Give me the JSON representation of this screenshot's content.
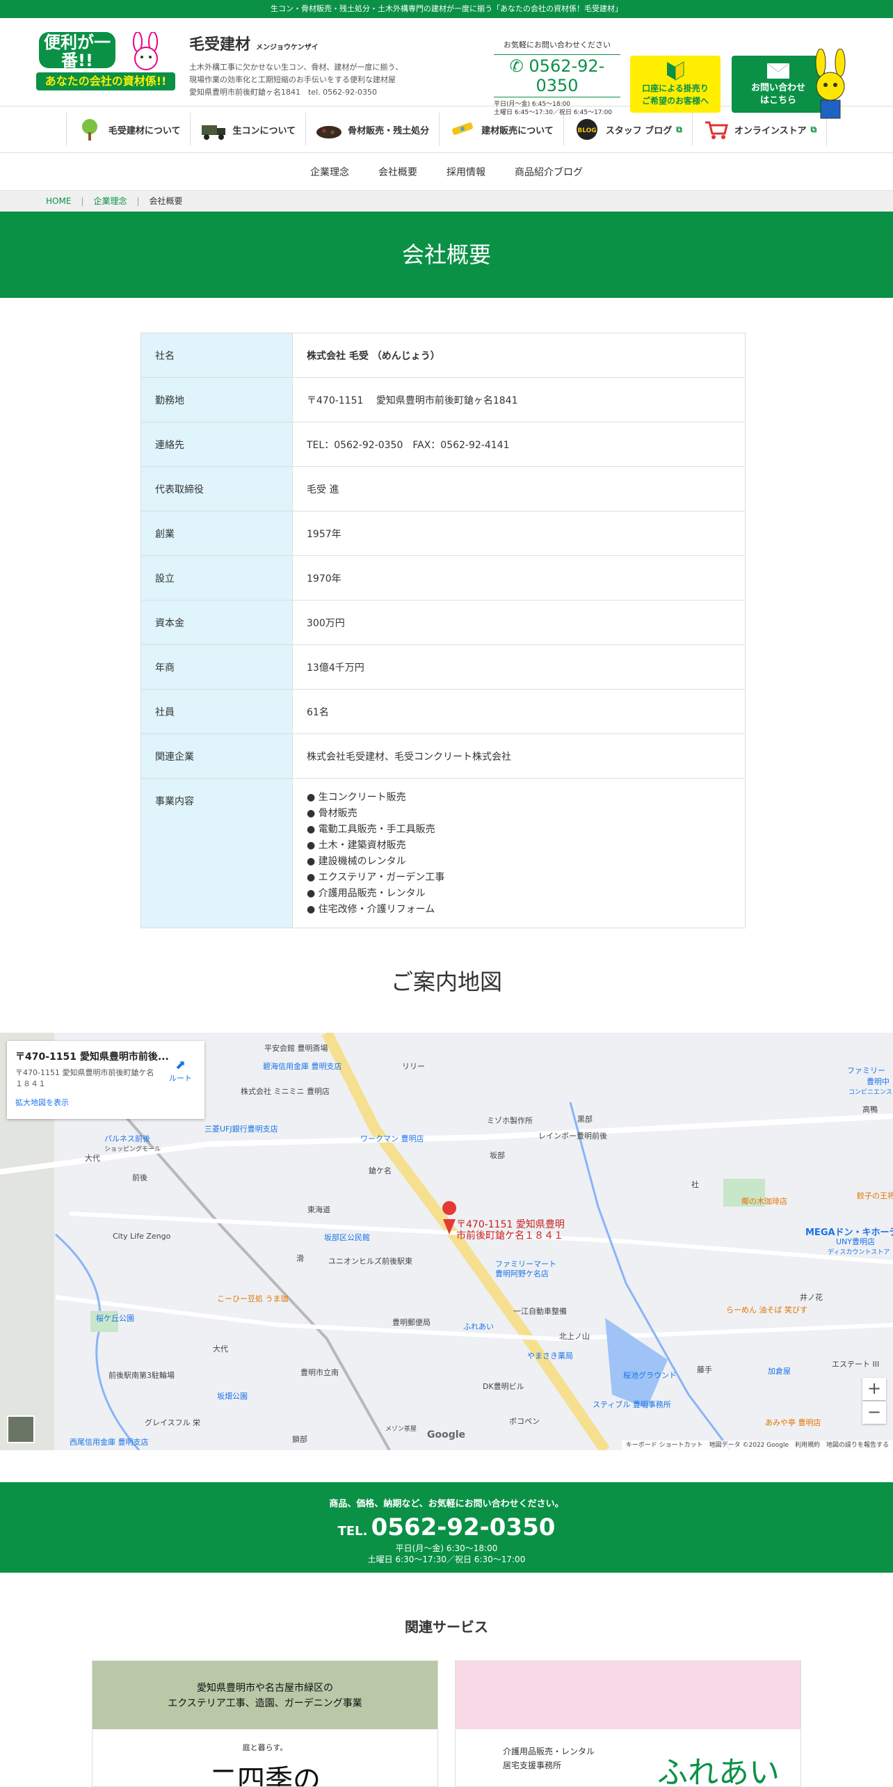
{
  "topbar": {
    "text": "生コン・骨材販売・残土処分・土木外構専門の建材が一度に揃う「あなたの会社の資材係！毛受建材」"
  },
  "header": {
    "logo_line1": "便利が一番!!",
    "logo_line2": "あなたの会社の資材係!!",
    "brand_name": "毛受建材",
    "brand_kana": "メンジョウケンザイ",
    "brand_desc1": "土木外構工事に欠かせない生コン、骨材、建材が一度に揃う、",
    "brand_desc2": "現場作業の効率化と工期短縮のお手伝いをする便利な建材屋",
    "brand_desc3": "愛知県豊明市前後町鎗ヶ名1841　tel. 0562-92-0350",
    "contact_caption": "お気軽にお問い合わせください",
    "tel": "0562-92-0350",
    "hours1": "平日(月〜金) 6:45〜18:00",
    "hours2": "土曜日 6:45〜17:30／祝日 6:45〜17:00",
    "btn_account_l1": "口座による掛売り",
    "btn_account_l2": "ご希望のお客様へ",
    "btn_contact_l1": "お問い合わせ",
    "btn_contact_l2": "はこちら"
  },
  "mainnav": [
    {
      "label": "毛受建材について",
      "icon": "tree-icon"
    },
    {
      "label": "生コンについて",
      "icon": "mixer-truck-icon"
    },
    {
      "label": "骨材販売・残土処分",
      "icon": "gravel-icon"
    },
    {
      "label": "建材販売について",
      "icon": "level-tool-icon"
    },
    {
      "label": "スタッフ ブログ",
      "icon": "blog-icon"
    },
    {
      "label": "オンラインストア",
      "icon": "cart-icon"
    }
  ],
  "subnav": [
    "企業理念",
    "会社概要",
    "採用情報",
    "商品紹介ブログ"
  ],
  "breadcrumb": {
    "home": "HOME",
    "parent": "企業理念",
    "current": "会社概要"
  },
  "page_title": "会社概要",
  "company": {
    "rows": [
      {
        "label": "社名",
        "value": "株式会社 毛受 （めんじょう）"
      },
      {
        "label": "勤務地",
        "value": "〒470-1151　 愛知県豊明市前後町鎗ヶ名1841"
      },
      {
        "label": "連絡先",
        "value": "TEL：0562-92-0350　FAX：0562-92-4141"
      },
      {
        "label": "代表取締役",
        "value": "毛受 進"
      },
      {
        "label": "創業",
        "value": "1957年"
      },
      {
        "label": "設立",
        "value": "1970年"
      },
      {
        "label": "資本金",
        "value": "300万円"
      },
      {
        "label": "年商",
        "value": "13億4千万円"
      },
      {
        "label": "社員",
        "value": "61名"
      },
      {
        "label": "関連企業",
        "value": "株式会社毛受建材、毛受コンクリート株式会社"
      }
    ],
    "business_label": "事業内容",
    "business": [
      "● 生コンクリート販売",
      "● 骨材販売",
      "● 電動工具販売・手工具販売",
      "● 土木・建築資材販売",
      "● 建設機械のレンタル",
      "● エクステリア・ガーデン工事",
      "● 介護用品販売・レンタル",
      "● 住宅改修・介護リフォーム"
    ]
  },
  "map": {
    "title": "ご案内地図",
    "card_title": "〒470-1151 愛知県豊明市前後...",
    "card_address": "〒470-1151 愛知県豊明市前後町鎗ケ名１８４１",
    "card_link": "拡大地図を表示",
    "route": "ルート",
    "pin_label1": "〒470-1151 愛知県豊明",
    "pin_label2": "市前後町鎗ケ名１８４１",
    "labels": [
      "平安会館 豊明斎場",
      "碧海信用金庫 豊明支店",
      "リリー",
      "株式会社 ミニミニ 豊明店",
      "三菱UFJ銀行豊明支店",
      "パルネス前後",
      "ショッピングモール",
      "ワークマン 豊明店",
      "ミゾホ製作所",
      "レインボー豊明前後",
      "黒部",
      "鎗ケ名",
      "坂部",
      "前後",
      "大代",
      "東海道",
      "坂部区公民館",
      "ユニオンヒルズ前後駅東",
      "ファミリーマート",
      "豊明阿野ケ名店",
      "City Life Zengo",
      "こーひー豆処 うま珈",
      "桜ケ丘公園",
      "豊明郵便局",
      "一江自動車整備",
      "北上ノ山",
      "ふれあい",
      "やまさき薬局",
      "桜池グラウンド",
      "DK豊明ビル",
      "スティブル 豊明事務所",
      "前後駅南第3駐輪場",
      "坂畑公園",
      "豊明市立南",
      "グレイスフル 栄",
      "メゾン茶屋",
      "西尾信用金庫 豊明支店",
      "ボコペン",
      "椰の木珈琲店",
      "MEGAドン・キホーテ",
      "UNY豊明店",
      "ディスカウントストア",
      "餃子の王将",
      "らーめん 油そば 笑びす",
      "井ノ花",
      "加倉屋",
      "エステート III",
      "あみや亭 豊明店",
      "藤手",
      "社",
      "高鴨",
      "ファミリー",
      "豊明中",
      "コンビニエンス",
      "大代",
      "滑",
      "鎖部"
    ],
    "zoom_in": "+",
    "zoom_out": "−",
    "google": "Google",
    "attribution": "キーボード ショートカット　地図データ ©2022 Google　利用規約　地図の誤りを報告する"
  },
  "cta": {
    "line1": "商品、価格、納期など、お気軽にお問い合わせください。",
    "tel_prefix": "TEL.",
    "tel": "0562-92-0350",
    "hours1": "平日(月〜金) 6:30〜18:00",
    "hours2": "土曜日 6:30〜17:30／祝日 6:30〜17:00"
  },
  "related": {
    "title": "関連サービス",
    "card1_banner1": "愛知県豊明市や名古屋市緑区の",
    "card1_banner2": "エクステリア工事、造園、ガーデニング事業",
    "card1_sub": "庭と暮らす。",
    "card1_big": "二四季の",
    "card2_sub1": "介護用品販売・レンタル",
    "card2_sub2": "居宅支援事務所",
    "card2_big": "ふれあい"
  },
  "colors": {
    "brand_green": "#0a9146",
    "table_head": "#dff4fb",
    "yellow": "#ffee00"
  }
}
